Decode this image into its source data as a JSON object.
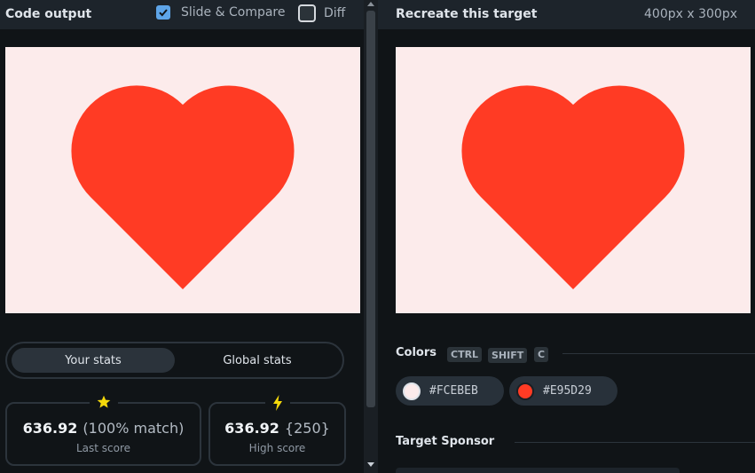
{
  "left_panel": {
    "title": "Code output",
    "slide_compare": {
      "label": "Slide & Compare",
      "checked": true
    },
    "diff": {
      "label": "Diff",
      "checked": false
    }
  },
  "right_panel": {
    "title": "Recreate this target",
    "dimensions": "400px x 300px"
  },
  "stats": {
    "tabs": [
      "Your stats",
      "Global stats"
    ],
    "active_tab": "Your stats",
    "last": {
      "score": "636.92",
      "detail": "(100% match)",
      "label": "Last score",
      "icon": "star-icon"
    },
    "high": {
      "score": "636.92",
      "detail": "{250}",
      "label": "High score",
      "icon": "lightning-icon"
    }
  },
  "colors": {
    "title": "Colors",
    "shortcut": [
      "CTRL",
      "SHIFT",
      "C"
    ],
    "swatches": [
      {
        "hex": "#FCEBEB",
        "color": "#fcebeb"
      },
      {
        "hex": "#E95D29",
        "color": "#ff3b24"
      }
    ]
  },
  "sponsor": {
    "title": "Target Sponsor"
  },
  "theme": {
    "background": "#fcebeb",
    "heart": "#ff3b24",
    "accent": "#5ea5e8",
    "star": "#f5d90a"
  }
}
